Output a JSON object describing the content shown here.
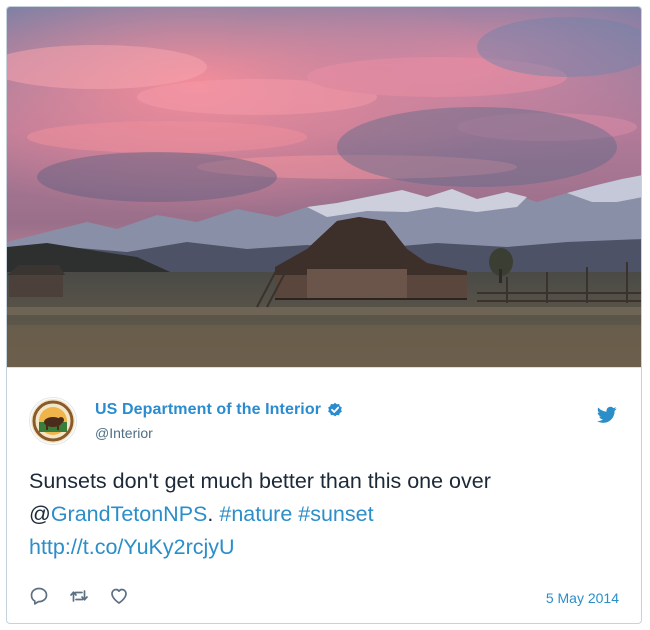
{
  "tweet": {
    "account_name": "US Department of the Interior",
    "handle": "@Interior",
    "text_plain_1": "Sunsets don't get much better than this one over",
    "mention_prefix": "@",
    "mention": "GrandTetonNPS",
    "text_plain_2": ".",
    "hashtag_1": "#nature",
    "hashtag_2": "#sunset",
    "url": "http://t.co/YuKy2rcjyU",
    "date": "5 May 2014"
  },
  "icons": {
    "verified": "verified-badge-icon",
    "brand": "twitter-bird-icon",
    "reply": "reply-icon",
    "retweet": "retweet-icon",
    "like": "heart-icon"
  },
  "colors": {
    "name": "#2a8ccf",
    "link": "#2b8ec9",
    "text": "#1c2938",
    "handle": "#4f6f86",
    "border": "#c6d3dc"
  }
}
